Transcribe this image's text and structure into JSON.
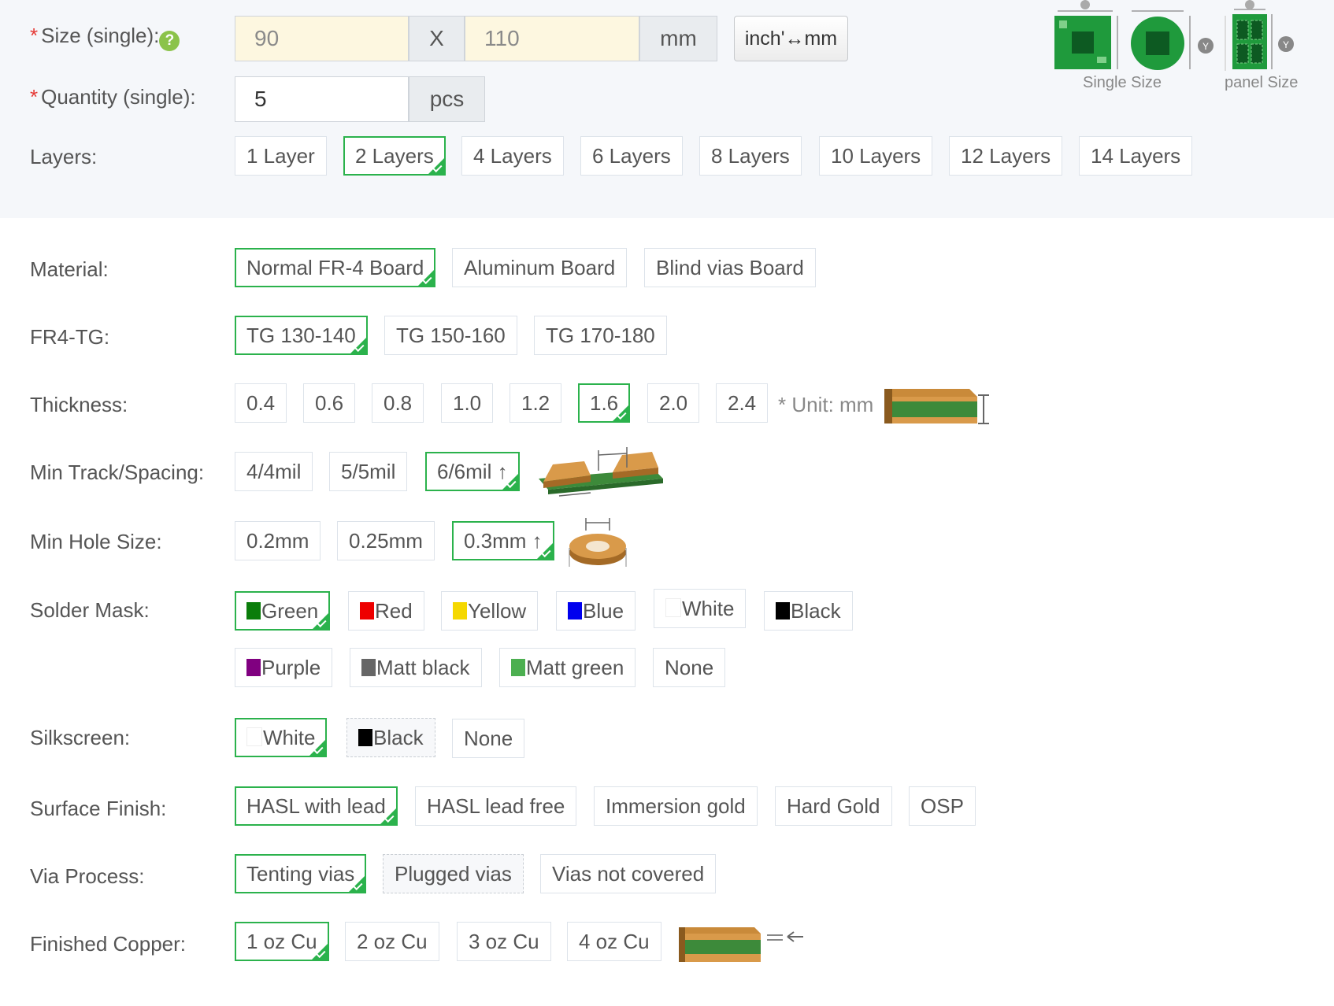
{
  "size": {
    "label": "Size (single):",
    "help_icon": "?",
    "width_value": "90",
    "separator": "X",
    "height_value": "110",
    "unit": "mm",
    "toggle_button": "inch'↔mm"
  },
  "quantity": {
    "label": "Quantity (single):",
    "value": "5",
    "unit": "pcs"
  },
  "size_images": {
    "single_caption": "Single Size",
    "panel_caption": "panel Size"
  },
  "layers": {
    "label": "Layers:",
    "options": [
      "1 Layer",
      "2 Layers",
      "4 Layers",
      "6 Layers",
      "8 Layers",
      "10 Layers",
      "12 Layers",
      "14 Layers"
    ],
    "selected": "2 Layers"
  },
  "material": {
    "label": "Material:",
    "options": [
      "Normal FR-4 Board",
      "Aluminum Board",
      "Blind vias Board"
    ],
    "selected": "Normal FR-4 Board"
  },
  "fr4_tg": {
    "label": "FR4-TG:",
    "options": [
      "TG 130-140",
      "TG 150-160",
      "TG 170-180"
    ],
    "selected": "TG 130-140"
  },
  "thickness": {
    "label": "Thickness:",
    "options": [
      "0.4",
      "0.6",
      "0.8",
      "1.0",
      "1.2",
      "1.6",
      "2.0",
      "2.4"
    ],
    "selected": "1.6",
    "unit_note": "* Unit: mm"
  },
  "track": {
    "label": "Min Track/Spacing:",
    "options": [
      "4/4mil",
      "5/5mil",
      "6/6mil ↑"
    ],
    "selected": "6/6mil ↑"
  },
  "hole": {
    "label": "Min Hole Size:",
    "options": [
      "0.2mm",
      "0.25mm",
      "0.3mm ↑"
    ],
    "selected": "0.3mm ↑"
  },
  "solder_mask": {
    "label": "Solder Mask:",
    "options": [
      {
        "label": "Green",
        "color": "#0a7d0a"
      },
      {
        "label": "Red",
        "color": "#ee0000"
      },
      {
        "label": "Yellow",
        "color": "#f5d800"
      },
      {
        "label": "Blue",
        "color": "#0000ee"
      },
      {
        "label": "White",
        "color": "#ffffff"
      },
      {
        "label": "Black",
        "color": "#000000"
      },
      {
        "label": "Purple",
        "color": "#800080"
      },
      {
        "label": "Matt black",
        "color": "#666666"
      },
      {
        "label": "Matt green",
        "color": "#4caf50"
      },
      {
        "label": "None",
        "color": ""
      }
    ],
    "selected": "Green"
  },
  "silkscreen": {
    "label": "Silkscreen:",
    "options": [
      {
        "label": "White",
        "color": "#ffffff"
      },
      {
        "label": "Black",
        "color": "#000000"
      },
      {
        "label": "None",
        "color": ""
      }
    ],
    "selected": "White"
  },
  "surface_finish": {
    "label": "Surface Finish:",
    "options": [
      "HASL with lead",
      "HASL lead free",
      "Immersion gold",
      "Hard Gold",
      "OSP"
    ],
    "selected": "HASL with lead"
  },
  "via_process": {
    "label": "Via Process:",
    "options": [
      "Tenting vias",
      "Plugged vias",
      "Vias not covered"
    ],
    "selected": "Tenting vias"
  },
  "finished_copper": {
    "label": "Finished Copper:",
    "options": [
      "1 oz Cu",
      "2 oz Cu",
      "3 oz Cu",
      "4 oz Cu"
    ],
    "selected": "1 oz Cu"
  },
  "colors": {
    "accent": "#2bb24c",
    "required": "#e53935",
    "board_green": "#3d8a3a",
    "copper": "#c98a3a"
  }
}
